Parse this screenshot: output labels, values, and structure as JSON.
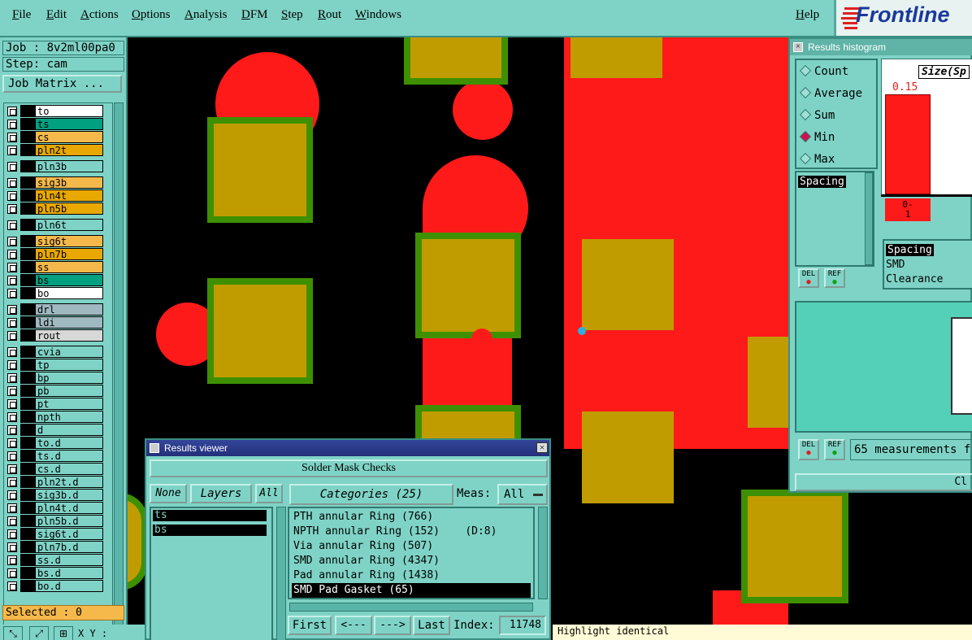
{
  "menubar": {
    "items": [
      "File",
      "Edit",
      "Actions",
      "Options",
      "Analysis",
      "DFM",
      "Step",
      "Rout",
      "Windows"
    ],
    "help": "Help",
    "logo": "Frontline"
  },
  "left": {
    "job": "Job : 8v2ml00pa0",
    "step": "Step: cam",
    "job_matrix": "Job Matrix ...",
    "selected": "Selected : 0",
    "xy_label": "X Y :",
    "layers": [
      {
        "name": "to",
        "color": "#ffffff"
      },
      {
        "name": "ts",
        "color": "#00a080"
      },
      {
        "name": "cs",
        "color": "#f5b94b"
      },
      {
        "name": "pln2t",
        "color": "#e8a800"
      },
      {
        "name": "pln3b",
        "color": "#7fd3c6"
      },
      {
        "name": "sig3b",
        "color": "#f5b94b"
      },
      {
        "name": "pln4t",
        "color": "#e8a800"
      },
      {
        "name": "pln5b",
        "color": "#e8a800"
      },
      {
        "name": "pln6t",
        "color": "#7fd3c6"
      },
      {
        "name": "sig6t",
        "color": "#f5b94b"
      },
      {
        "name": "pln7b",
        "color": "#e8a800"
      },
      {
        "name": "ss",
        "color": "#f5b94b"
      },
      {
        "name": "bs",
        "color": "#00a080"
      },
      {
        "name": "bo",
        "color": "#ffffff"
      },
      {
        "name": "drl",
        "color": "#a0b8c0"
      },
      {
        "name": "ldi",
        "color": "#a0b8c0"
      },
      {
        "name": "rout",
        "color": "#d8d8d8"
      },
      {
        "name": "cvia",
        "color": "#7fd3c6"
      },
      {
        "name": "tp",
        "color": "#7fd3c6"
      },
      {
        "name": "bp",
        "color": "#7fd3c6"
      },
      {
        "name": "pb",
        "color": "#7fd3c6"
      },
      {
        "name": "pt",
        "color": "#7fd3c6"
      },
      {
        "name": "npth",
        "color": "#7fd3c6"
      },
      {
        "name": "d",
        "color": "#7fd3c6"
      },
      {
        "name": "to.d",
        "color": "#7fd3c6"
      },
      {
        "name": "ts.d",
        "color": "#7fd3c6"
      },
      {
        "name": "cs.d",
        "color": "#7fd3c6"
      },
      {
        "name": "pln2t.d",
        "color": "#7fd3c6"
      },
      {
        "name": "sig3b.d",
        "color": "#7fd3c6"
      },
      {
        "name": "pln4t.d",
        "color": "#7fd3c6"
      },
      {
        "name": "pln5b.d",
        "color": "#7fd3c6"
      },
      {
        "name": "sig6t.d",
        "color": "#7fd3c6"
      },
      {
        "name": "pln7b.d",
        "color": "#7fd3c6"
      },
      {
        "name": "ss.d",
        "color": "#7fd3c6"
      },
      {
        "name": "bs.d",
        "color": "#7fd3c6"
      },
      {
        "name": "bo.d",
        "color": "#7fd3c6"
      }
    ]
  },
  "histogram": {
    "title": "Results histogram",
    "modes": [
      "Count",
      "Average",
      "Sum",
      "Min",
      "Max"
    ],
    "selected_mode": "Min",
    "size_label": "Size(Sp",
    "bar_value": "0.15",
    "range_label": "0-\n1",
    "list_left": [
      "Spacing"
    ],
    "list_right": [
      "Spacing",
      "SMD",
      "Clearance"
    ],
    "del": "DEL",
    "ref": "REF",
    "measurements": "65 measurements f",
    "close": "Cl"
  },
  "viewer": {
    "title": "Results viewer",
    "header": "Solder Mask Checks",
    "none": "None",
    "layers": "Layers",
    "all": "All",
    "categories": "Categories (25)",
    "meas_label": "Meas:",
    "meas_value": "All",
    "layer_items": [
      "ts",
      "bs"
    ],
    "category_items": [
      "PTH annular Ring (766)",
      "NPTH annular Ring (152)    (D:8)",
      "Via annular Ring (507)",
      "SMD annular Ring (4347)",
      "Pad annular Ring (1438)",
      "SMD Pad Gasket (65)"
    ],
    "selected_category": "SMD Pad Gasket (65)",
    "first": "First",
    "prev": "<---",
    "next": "--->",
    "last": "Last",
    "index_label": "Index:",
    "index_value": "11748"
  },
  "tooltip": "Highlight identical"
}
